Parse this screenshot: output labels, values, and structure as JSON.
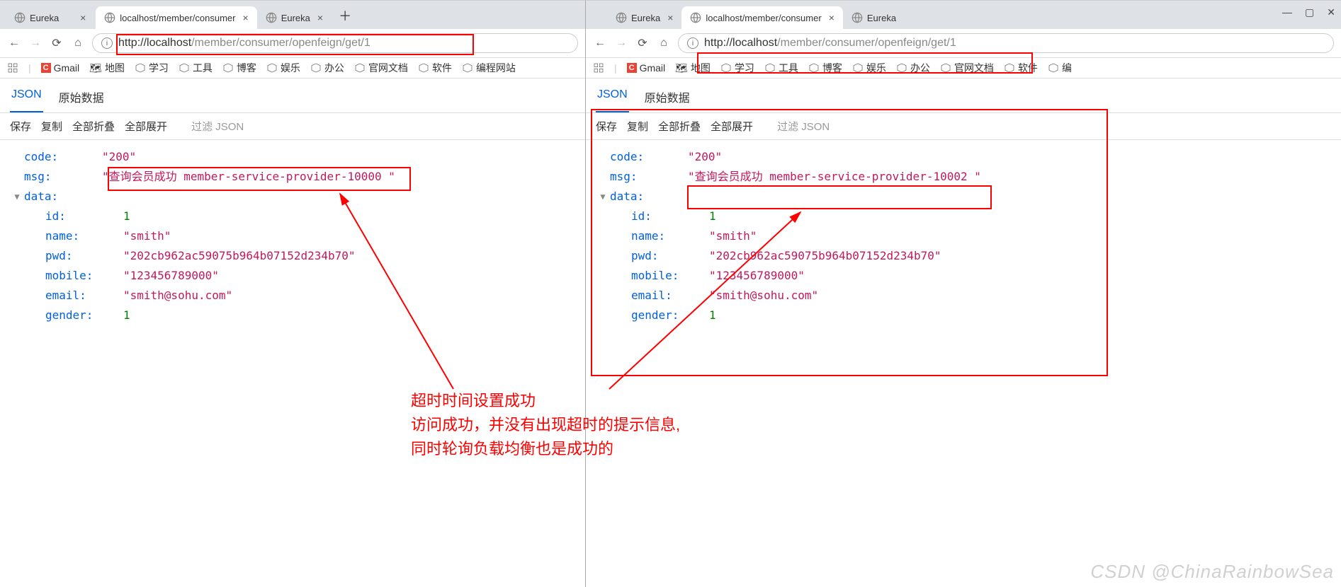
{
  "left": {
    "tabs": [
      {
        "label": "Eureka",
        "active": false,
        "favicon": "globe"
      },
      {
        "label": "localhost/member/consumer",
        "active": true,
        "favicon": "globe"
      },
      {
        "label": "Eureka",
        "active": false,
        "favicon": "globe"
      }
    ],
    "url_host": "http://localhost",
    "url_path": "/member/consumer/openfeign/get/1",
    "bookmarks": {
      "gmail": "Gmail",
      "map": "地图",
      "study": "学习",
      "tool": "工具",
      "blog": "博客",
      "ent": "娱乐",
      "office": "办公",
      "doc": "官网文档",
      "soft": "软件",
      "code": "编程网站"
    },
    "json_tabs": {
      "json": "JSON",
      "raw": "原始数据"
    },
    "toolbar": {
      "save": "保存",
      "copy": "复制",
      "collapse": "全部折叠",
      "expand": "全部展开",
      "filter": "过滤 JSON"
    },
    "json": {
      "code_key": "code:",
      "code": "\"200\"",
      "msg_key": "msg:",
      "msg": "\"查询会员成功 member-service-provider-10000 \"",
      "data_key": "data:",
      "id_key": "id:",
      "id": "1",
      "name_key": "name:",
      "name": "\"smith\"",
      "pwd_key": "pwd:",
      "pwd": "\"202cb962ac59075b964b07152d234b70\"",
      "mobile_key": "mobile:",
      "mobile": "\"123456789000\"",
      "email_key": "email:",
      "email": "\"smith@sohu.com\"",
      "gender_key": "gender:",
      "gender": "1"
    }
  },
  "right": {
    "tabs": [
      {
        "label": "Eureka",
        "active": false
      },
      {
        "label": "localhost/member/consumer",
        "active": true
      },
      {
        "label": "Eureka",
        "active": false
      }
    ],
    "url_host": "http://localhost",
    "url_path": "/member/consumer/openfeign/get/1",
    "bookmarks": {
      "gmail": "Gmail",
      "map": "地图",
      "study": "学习",
      "tool": "工具",
      "blog": "博客",
      "ent": "娱乐",
      "office": "办公",
      "doc": "官网文档",
      "soft": "软件",
      "code": "编"
    },
    "json_tabs": {
      "json": "JSON",
      "raw": "原始数据"
    },
    "toolbar": {
      "save": "保存",
      "copy": "复制",
      "collapse": "全部折叠",
      "expand": "全部展开",
      "filter": "过滤 JSON"
    },
    "json": {
      "code_key": "code:",
      "code": "\"200\"",
      "msg_key": "msg:",
      "msg": "\"查询会员成功 member-service-provider-10002 \"",
      "data_key": "data:",
      "id_key": "id:",
      "id": "1",
      "name_key": "name:",
      "name": "\"smith\"",
      "pwd_key": "pwd:",
      "pwd": "\"202cb962ac59075b964b07152d234b70\"",
      "mobile_key": "mobile:",
      "mobile": "\"123456789000\"",
      "email_key": "email:",
      "email": "\"smith@sohu.com\"",
      "gender_key": "gender:",
      "gender": "1"
    }
  },
  "annotation": {
    "l1": "超时时间设置成功",
    "l2": "访问成功，并没有出现超时的提示信息,",
    "l3": "同时轮询负载均衡也是成功的"
  },
  "watermark": "CSDN @ChinaRainbowSea"
}
